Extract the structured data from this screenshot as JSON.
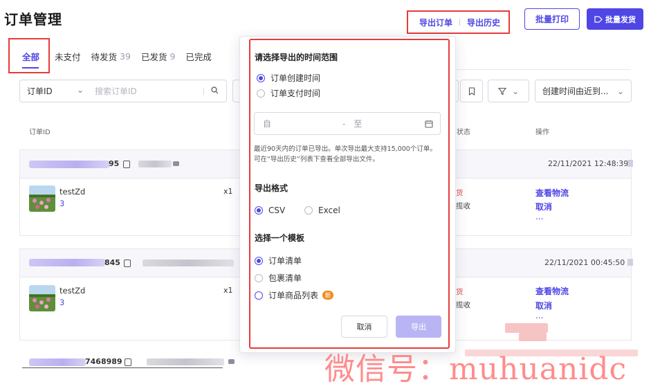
{
  "header": {
    "title": "订单管理",
    "export_orders": "导出订单",
    "export_history": "导出历史",
    "batch_print": "批量打印",
    "batch_ship": "批量发货"
  },
  "tabs": [
    {
      "label": "全部",
      "count": ""
    },
    {
      "label": "未支付",
      "count": ""
    },
    {
      "label": "待发货",
      "count": "39"
    },
    {
      "label": "已发货",
      "count": "9"
    },
    {
      "label": "已完成",
      "count": ""
    }
  ],
  "filter": {
    "field_select": "订单ID",
    "search_placeholder": "搜索订单ID",
    "sort_select": "创建时间由近到..."
  },
  "table_headers": {
    "order_id": "订单ID",
    "status": "状态",
    "actions": "操作"
  },
  "orders": [
    {
      "id_tail": "95",
      "timestamp": "22/11/2021 12:48:39",
      "product": "testZd",
      "variant": "3",
      "qty": "x1",
      "status_top": "货",
      "status_bottom": "揽收",
      "action_1": "查看物流",
      "action_2": "取消",
      "more": "..."
    },
    {
      "id_tail": "845",
      "timestamp": "22/11/2021 00:45:50",
      "product": "testZd",
      "variant": "3",
      "qty": "x1",
      "status_top": "货",
      "status_bottom": "揽收",
      "action_1": "查看物流",
      "action_2": "取消",
      "more": "..."
    },
    {
      "id_tail": "7468989"
    }
  ],
  "popover": {
    "time_range_title": "请选择导出的时间范围",
    "opt_created": "订单创建时间",
    "opt_paid": "订单支付时间",
    "date_from": "自",
    "date_sep": "-",
    "date_to": "至",
    "note": "最近90天内的订单已导出。单次导出最大支持15,000个订单。可在“导出历史”列表下查看全部导出文件。",
    "format_title": "导出格式",
    "fmt_csv": "CSV",
    "fmt_excel": "Excel",
    "template_title": "选择一个模板",
    "tpl_order_list": "订单清单",
    "tpl_package_list": "包裹清单",
    "tpl_product_list": "订单商品列表",
    "new_badge": "新",
    "cancel": "取消",
    "export": "导出"
  },
  "watermark": "微信号：muhuanidc",
  "colors": {
    "primary": "#4f46e5",
    "highlight_red": "#e83a3a",
    "export_disabled": "#b9b5f5",
    "badge_orange": "#f08a1d"
  }
}
